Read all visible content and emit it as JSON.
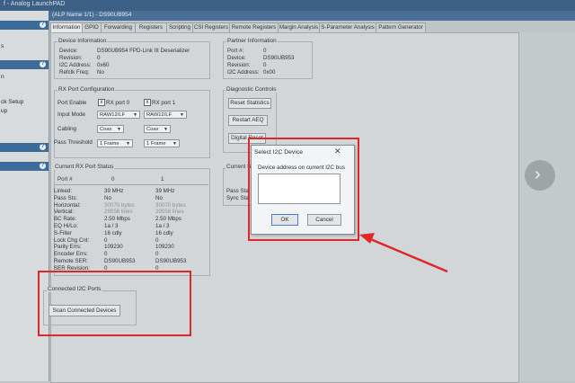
{
  "app": {
    "title": "f - Analog LaunchPAD",
    "window_title": "(ALP Name 1/1) - DS90UB954"
  },
  "sidebar": {
    "help_icon": "?",
    "fragments": [
      "s",
      "ck Setup",
      "up",
      "n"
    ]
  },
  "tabs": [
    {
      "label": "Information",
      "active": true
    },
    {
      "label": "GPIO"
    },
    {
      "label": "Forwarding"
    },
    {
      "label": "Registers"
    },
    {
      "label": "Scripting"
    },
    {
      "label": "CSI Registers"
    },
    {
      "label": "Remote Registers"
    },
    {
      "label": "Margin Analysis"
    },
    {
      "label": "S-Parameter Analysis"
    },
    {
      "label": "Pattern Generator"
    }
  ],
  "device_info": {
    "title": "Device Information",
    "rows": [
      {
        "label": "Device:",
        "value": "DS90UB954 FPD-Link III Deserializer"
      },
      {
        "label": "Revision:",
        "value": "0"
      },
      {
        "label": "I2C Address:",
        "value": "0x60"
      },
      {
        "label": "Refclk Freq:",
        "value": "No"
      }
    ]
  },
  "partner_info": {
    "title": "Partner Information",
    "rows": [
      {
        "label": "Port #:",
        "value": "0"
      },
      {
        "label": "Device:",
        "value": "DS90UB953"
      },
      {
        "label": "Revision:",
        "value": "0"
      },
      {
        "label": "I2C Address:",
        "value": "0x00"
      }
    ]
  },
  "rx_port_config": {
    "title": "RX Port Configuration",
    "port_enable_label": "Port Enable",
    "port0_label": "RX port 0",
    "port1_label": "RX port 1",
    "port0_checked": "x",
    "port1_checked": "x",
    "input_mode_label": "Input Mode",
    "input_mode_0": "RAW12/LF",
    "input_mode_1": "RAW12/LF",
    "cabling_label": "Cabling",
    "cabling_0": "Coax",
    "cabling_1": "Coax",
    "pass_threshold_label": "Pass Threshold",
    "pass_threshold_0": "1 Frame",
    "pass_threshold_1": "1 Frame"
  },
  "diagnostic": {
    "title": "Diagnostic Controls",
    "reset_stats": "Reset Statistics",
    "restart_aeq": "Restart AEQ",
    "digital_reset": "Digital Reset"
  },
  "rx_status": {
    "title": "Current RX Port Status",
    "port_label": "Port #",
    "port0": "0",
    "port1": "1",
    "rows": [
      {
        "label": "Linked:",
        "v0": "39 MHz",
        "v1": "39 MHz",
        "dim": false
      },
      {
        "label": "Pass Sts:",
        "v0": "No",
        "v1": "No",
        "dim": false
      },
      {
        "label": "Horizontal:",
        "v0": "30070 bytes",
        "v1": "30070 bytes",
        "dim": true
      },
      {
        "label": "Vertical:",
        "v0": "29556 lines",
        "v1": "29556 lines",
        "dim": true
      },
      {
        "label": "BC Rate:",
        "v0": "2.50 Mbps",
        "v1": "2.50 Mbps",
        "dim": false
      },
      {
        "label": "EQ Hi/Lo:",
        "v0": "1a / 3",
        "v1": "1a / 3",
        "dim": false
      },
      {
        "label": "S-Filter",
        "v0": "16 cdly",
        "v1": "16 cdly",
        "dim": false
      },
      {
        "label": "Lock Chg Cnt:",
        "v0": "0",
        "v1": "0",
        "dim": false
      },
      {
        "label": "Parity Errs:",
        "v0": "109230",
        "v1": "109230",
        "dim": false
      },
      {
        "label": "Encoder Errs:",
        "v0": "0",
        "v1": "0",
        "dim": false
      },
      {
        "label": "Remote SER:",
        "v0": "DS90UB953",
        "v1": "DS90UB953",
        "dim": false
      },
      {
        "label": "SER Revision:",
        "v0": "0",
        "v1": "0",
        "dim": false
      }
    ]
  },
  "csi_status": {
    "title_fragment": "Current S",
    "rows": [
      "Pass Sta",
      "Sync Sta"
    ]
  },
  "connected_i2c": {
    "title": "Connected I2C Ports",
    "scan_button": "Scan Connected Devices"
  },
  "dialog": {
    "title": "Select I2C Device",
    "close": "✕",
    "prompt": "Device address on current I2C bus",
    "text_value": "",
    "ok": "OK",
    "cancel": "Cancel"
  },
  "nav": {
    "next": "›"
  },
  "colors": {
    "annotation": "#e0262b",
    "title_bar": "#4a6f96"
  }
}
